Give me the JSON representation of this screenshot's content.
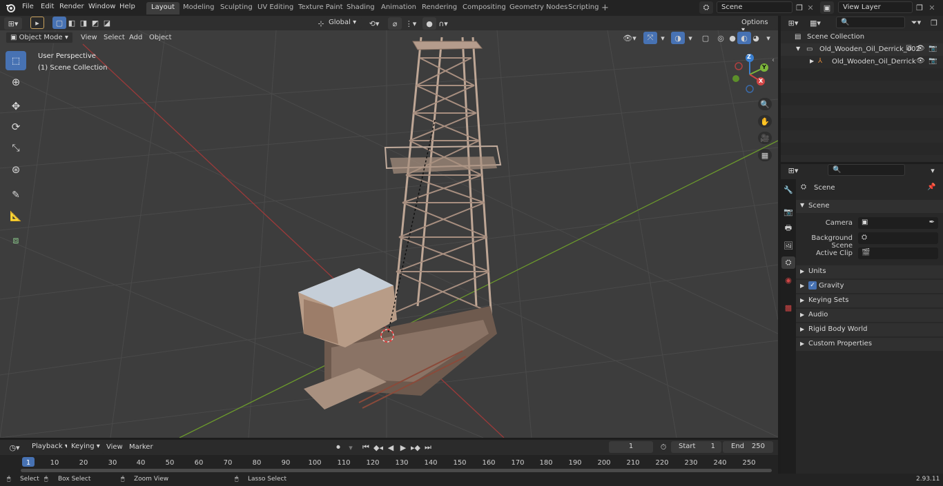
{
  "menu": [
    "File",
    "Edit",
    "Render",
    "Window",
    "Help"
  ],
  "workspaces": [
    "Layout",
    "Modeling",
    "Sculpting",
    "UV Editing",
    "Texture Paint",
    "Shading",
    "Animation",
    "Rendering",
    "Compositing",
    "Geometry Nodes",
    "Scripting"
  ],
  "active_workspace": "Layout",
  "scene_name": "Scene",
  "view_layer": "View Layer",
  "viewport": {
    "mode": "Object Mode",
    "menus": [
      "View",
      "Select",
      "Add",
      "Object"
    ],
    "transform_orientation": "Global",
    "options_label": "Options",
    "overlay_title": "User Perspective",
    "overlay_subtitle": "(1) Scene Collection",
    "gizmo": {
      "x": "X",
      "y": "Y",
      "z": "Z"
    }
  },
  "outliner": {
    "root": "Scene Collection",
    "items": [
      {
        "label": "Old_Wooden_Oil_Derrick_002",
        "level": 1
      },
      {
        "label": "Old_Wooden_Oil_Derrick",
        "level": 2
      }
    ]
  },
  "properties": {
    "context_label": "Scene",
    "panel_title": "Scene",
    "fields": [
      {
        "label": "Camera"
      },
      {
        "label": "Background Scene"
      },
      {
        "label": "Active Clip"
      }
    ],
    "sections": [
      "Units",
      "Gravity",
      "Keying Sets",
      "Audio",
      "Rigid Body World",
      "Custom Properties"
    ],
    "gravity_checked": true
  },
  "timeline": {
    "menus": [
      "Playback",
      "Keying",
      "View",
      "Marker"
    ],
    "current_frame": "1",
    "start_label": "Start",
    "start_value": "1",
    "end_label": "End",
    "end_value": "250",
    "ruler": [
      "1",
      "10",
      "20",
      "30",
      "40",
      "50",
      "60",
      "70",
      "80",
      "90",
      "100",
      "110",
      "120",
      "130",
      "140",
      "150",
      "160",
      "170",
      "180",
      "190",
      "200",
      "210",
      "220",
      "230",
      "240",
      "250"
    ]
  },
  "statusbar": {
    "items": [
      "Select",
      "Box Select",
      "Zoom View",
      "Lasso Select"
    ],
    "version": "2.93.11"
  }
}
